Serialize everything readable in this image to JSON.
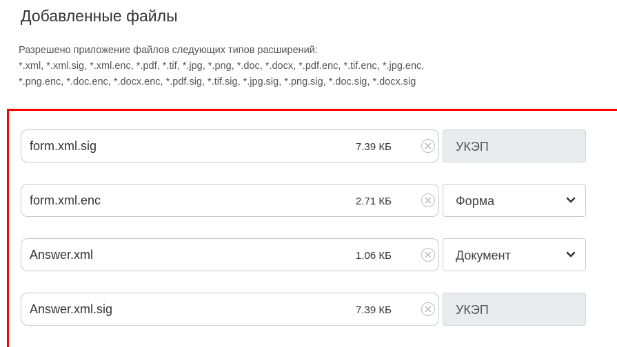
{
  "section": {
    "title": "Добавленные файлы",
    "hint_line1": "Разрешено приложение файлов следующих типов расширений:",
    "hint_line2": "*.xml, *.xml.sig, *.xml.enc, *.pdf, *.tif, *.jpg, *.png, *.doc, *.docx, *.pdf.enc, *.tif.enc, *.jpg.enc,",
    "hint_line3": "*.png.enc, *.doc.enc, *.docx.enc, *.pdf.sig, *.tif.sig, *.jpg.sig, *.png.sig, *.doc.sig, *.docx.sig"
  },
  "files": [
    {
      "name": "form.xml.sig",
      "size": "7.39 КБ",
      "type": "УКЭП",
      "type_control": "readonly"
    },
    {
      "name": "form.xml.enc",
      "size": "2.71 КБ",
      "type": "Форма",
      "type_control": "select"
    },
    {
      "name": "Answer.xml",
      "size": "1.06 КБ",
      "type": "Документ",
      "type_control": "select"
    },
    {
      "name": "Answer.xml.sig",
      "size": "7.39 КБ",
      "type": "УКЭП",
      "type_control": "readonly"
    }
  ],
  "icons": {
    "remove": "close-circle-icon",
    "dropdown": "chevron-down-icon"
  },
  "colors": {
    "highlight_frame": "#ff0000",
    "readonly_background": "#e9ecef",
    "field_border": "#c8c8c8"
  }
}
